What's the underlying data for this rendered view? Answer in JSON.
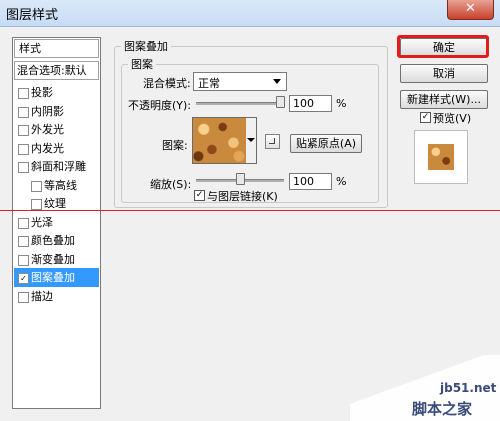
{
  "window": {
    "title": "图层样式",
    "close_glyph": "✕"
  },
  "styles_list": {
    "header": "样式",
    "blend_default": "混合选项:默认",
    "items": [
      {
        "label": "投影",
        "checked": false,
        "indent": false
      },
      {
        "label": "内阴影",
        "checked": false,
        "indent": false
      },
      {
        "label": "外发光",
        "checked": false,
        "indent": false
      },
      {
        "label": "内发光",
        "checked": false,
        "indent": false
      },
      {
        "label": "斜面和浮雕",
        "checked": false,
        "indent": false
      },
      {
        "label": "等高线",
        "checked": false,
        "indent": true
      },
      {
        "label": "纹理",
        "checked": false,
        "indent": true
      },
      {
        "label": "光泽",
        "checked": false,
        "indent": false
      },
      {
        "label": "颜色叠加",
        "checked": false,
        "indent": false
      },
      {
        "label": "渐变叠加",
        "checked": false,
        "indent": false
      },
      {
        "label": "图案叠加",
        "checked": true,
        "indent": false,
        "selected": true
      },
      {
        "label": "描边",
        "checked": false,
        "indent": false
      }
    ]
  },
  "pattern_overlay": {
    "group_title": "图案叠加",
    "sub_title": "图案",
    "blend_mode_label": "混合模式:",
    "blend_mode_value": "正常",
    "opacity_label": "不透明度(Y):",
    "opacity_value": "100",
    "opacity_unit": "%",
    "opacity_level": 1.0,
    "pattern_label": "图案:",
    "snap_origin_label": "贴紧原点(A)",
    "scale_label": "缩放(S):",
    "scale_value": "100",
    "scale_unit": "%",
    "scale_level": 0.5,
    "link_label": "与图层链接(K)",
    "link_checked": true
  },
  "buttons": {
    "ok": "确定",
    "cancel": "取消",
    "new_style": "新建样式(W)...",
    "preview_label": "预览(V)",
    "preview_checked": true
  },
  "watermark": {
    "site": "jb51.net",
    "name": "脚本之家"
  },
  "colors": {
    "highlight_red": "#e31b1b",
    "selection_blue": "#3399ff"
  }
}
